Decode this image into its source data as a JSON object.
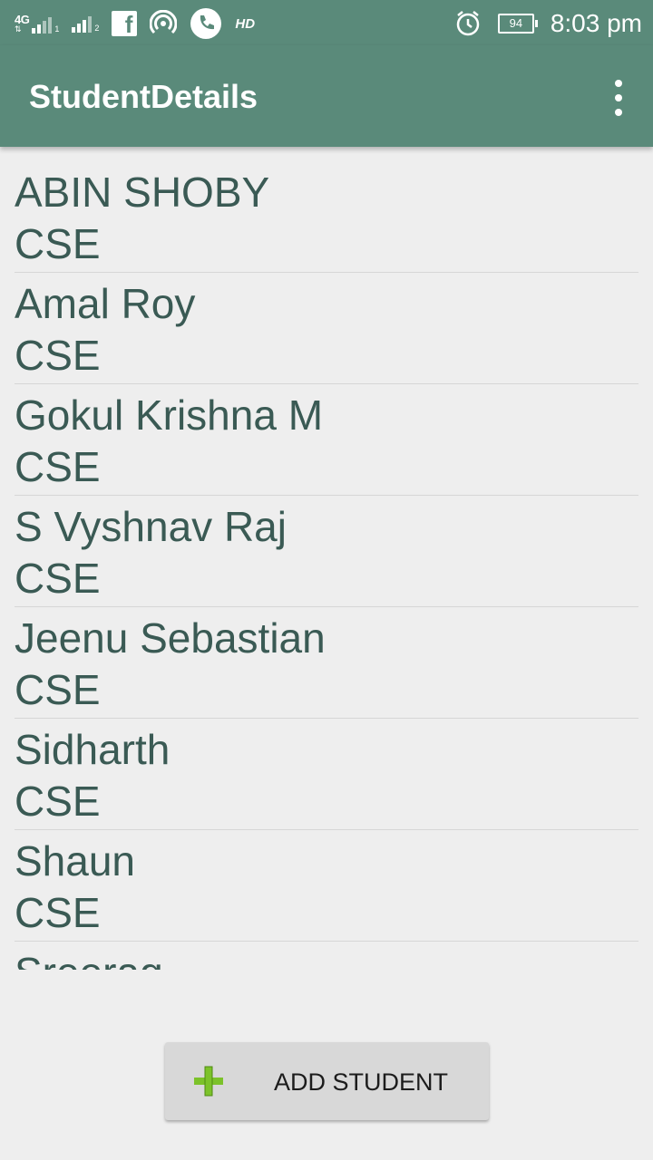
{
  "status_bar": {
    "network_label": "4G",
    "sim1": "1",
    "sim2": "2",
    "icons": [
      "signal-icon",
      "facebook-icon",
      "hotspot-icon",
      "phone-icon",
      "alarm-icon",
      "battery-icon"
    ],
    "hd": "HD",
    "battery": "94",
    "time": "8:03 pm"
  },
  "app_bar": {
    "title": "StudentDetails",
    "menu_icon": "more-vert-icon"
  },
  "students": [
    {
      "name": "ABIN SHOBY",
      "dept": "CSE"
    },
    {
      "name": "Amal Roy",
      "dept": "CSE"
    },
    {
      "name": "Gokul Krishna M",
      "dept": "CSE"
    },
    {
      "name": "S Vyshnav Raj",
      "dept": "CSE"
    },
    {
      "name": "Jeenu Sebastian",
      "dept": "CSE"
    },
    {
      "name": "Sidharth",
      "dept": "CSE"
    },
    {
      "name": "Shaun",
      "dept": "CSE"
    },
    {
      "name": "Sreerag",
      "dept": ""
    }
  ],
  "add_button": {
    "label": "ADD STUDENT",
    "icon": "plus-icon"
  },
  "colors": {
    "primary": "#5a8a7a",
    "text": "#3a5a54",
    "plus_green": "#7cc22a"
  }
}
